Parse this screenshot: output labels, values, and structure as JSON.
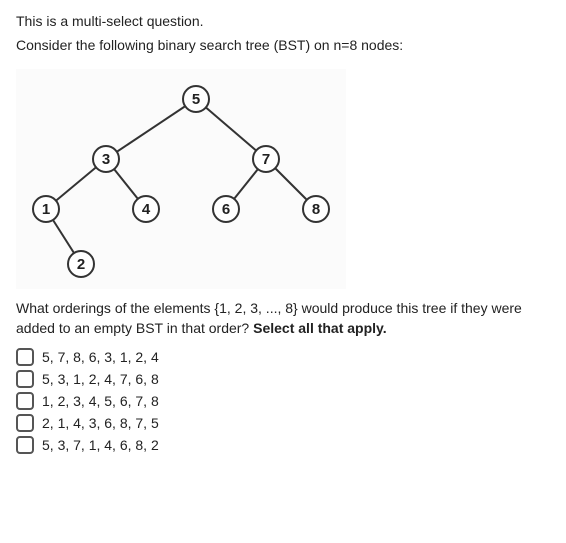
{
  "intro": {
    "line1": "This is a multi-select question.",
    "line2": "Consider the following binary search tree (BST) on n=8 nodes:"
  },
  "tree": {
    "nodes": {
      "n5": "5",
      "n3": "3",
      "n7": "7",
      "n1": "1",
      "n4": "4",
      "n6": "6",
      "n8": "8",
      "n2": "2"
    }
  },
  "question": {
    "text_part1": "What orderings of the elements {1, 2, 3, ..., 8} would produce this tree if they were added to an empty BST in that order? ",
    "text_strong": "Select all that apply."
  },
  "options": [
    {
      "label": "5, 7, 8, 6, 3, 1, 2, 4"
    },
    {
      "label": "5, 3, 1, 2, 4, 7, 6, 8"
    },
    {
      "label": "1, 2, 3, 4, 5, 6, 7, 8"
    },
    {
      "label": "2, 1, 4, 3, 6, 8, 7, 5"
    },
    {
      "label": "5, 3, 7, 1, 4, 6, 8, 2"
    }
  ]
}
